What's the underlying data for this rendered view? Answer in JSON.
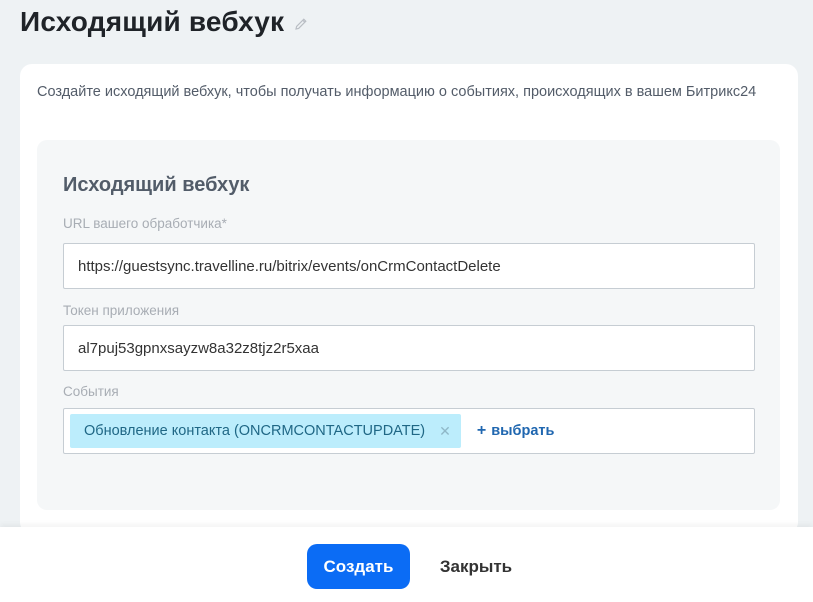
{
  "header": {
    "title": "Исходящий вебхук",
    "edit_icon": "pencil-icon"
  },
  "card": {
    "description": "Создайте исходящий вебхук, чтобы получать информацию о событиях, происходящих в вашем Битрикс24"
  },
  "form": {
    "title": "Исходящий вебхук",
    "url_label": "URL вашего обработчика*",
    "url_value": "https://guestsync.travelline.ru/bitrix/events/onCrmContactDelete",
    "token_label": "Токен приложения",
    "token_value": "al7puj53gpnxsayzw8a32z8tjz2r5xaa",
    "events_label": "События",
    "events": [
      {
        "label": "Обновление контакта (ONCRMCONTACTUPDATE)",
        "remove_icon": "close-icon"
      }
    ],
    "select_label": "выбрать",
    "select_icon": "plus-icon"
  },
  "footer": {
    "create_label": "Создать",
    "close_label": "Закрыть"
  },
  "colors": {
    "page_background": "#eef2f4",
    "primary_button": "#0b6cf5",
    "tag_background": "#bcedfc",
    "tag_text": "#1f6785",
    "link": "#2067b0"
  }
}
